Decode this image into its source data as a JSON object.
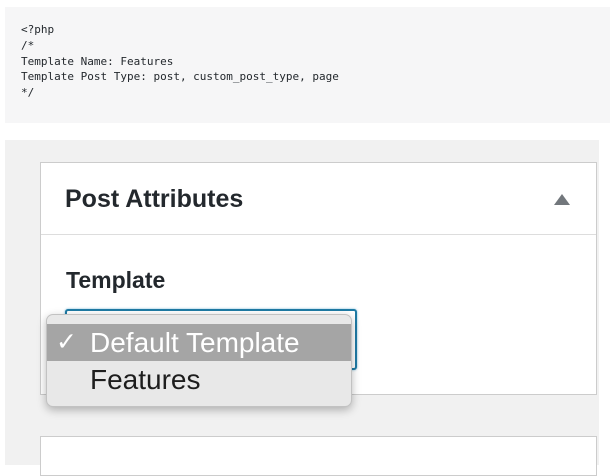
{
  "code_snippet": {
    "lines": [
      "<?php",
      "/*",
      "Template Name: Features",
      "Template Post Type: post, custom_post_type, page",
      "*/"
    ]
  },
  "post_attributes": {
    "title": "Post Attributes",
    "toggle_icon": "triangle-up-icon",
    "template_label": "Template",
    "template_select": {
      "selected_value": "Default Template",
      "options": [
        {
          "label": "Default Template",
          "selected": true,
          "mark": "✓"
        },
        {
          "label": "Features",
          "selected": false,
          "mark": ""
        }
      ]
    }
  },
  "colors": {
    "admin_background": "#f1f1f1",
    "focus_border": "#1e7aa4",
    "menu_highlight": "#a5a5a5"
  }
}
